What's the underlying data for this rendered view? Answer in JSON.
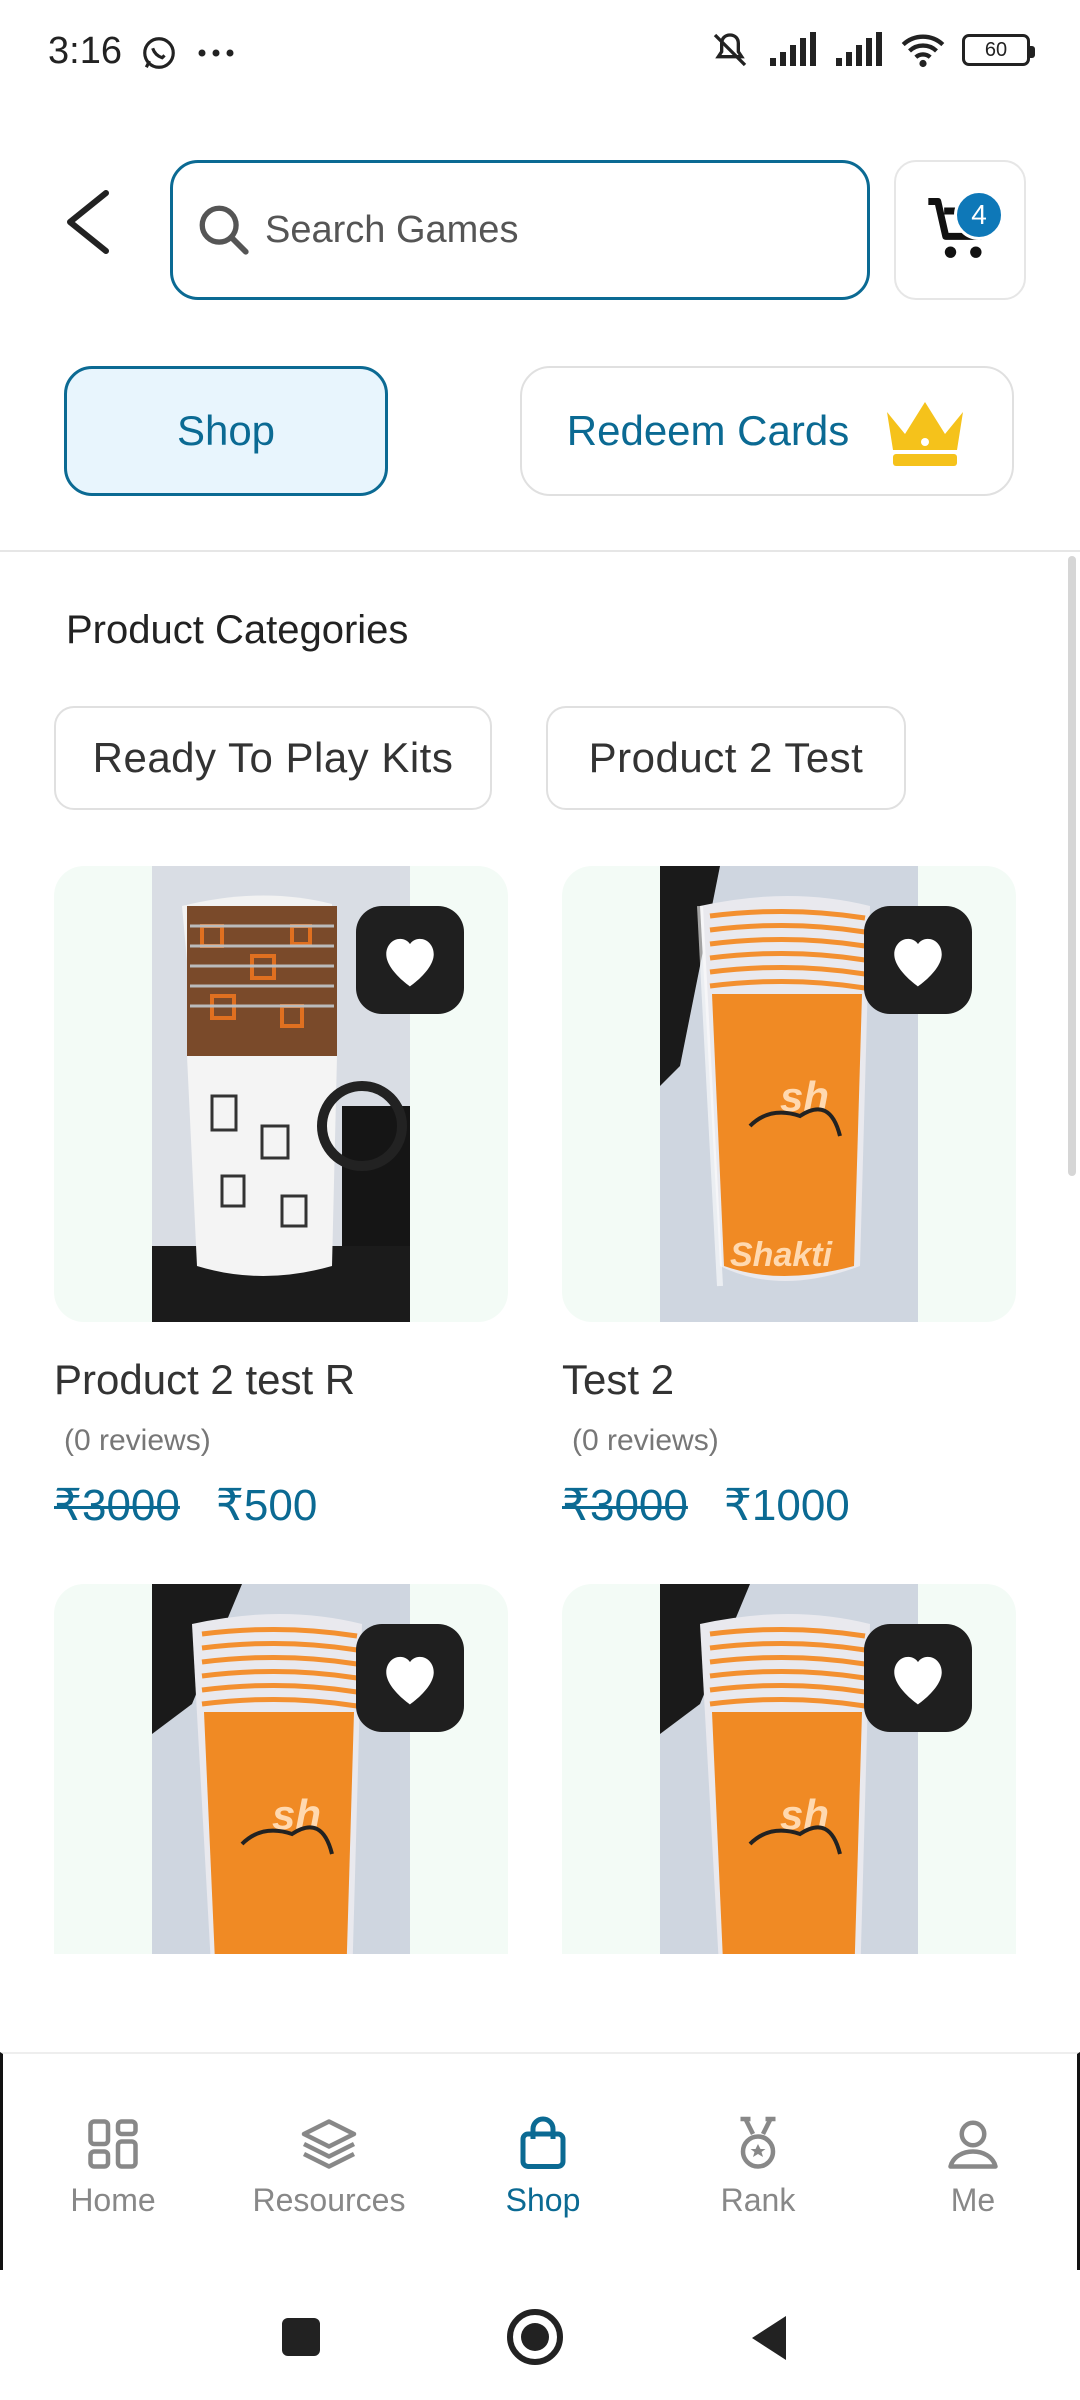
{
  "status_bar": {
    "time": "3:16",
    "battery": "60"
  },
  "header": {
    "search_placeholder": "Search Games",
    "cart_count": "4"
  },
  "top_tabs": {
    "shop": "Shop",
    "redeem": "Redeem Cards"
  },
  "categories": {
    "title": "Product Categories",
    "items": [
      "Ready To Play Kits",
      "Product 2 Test"
    ]
  },
  "products": [
    {
      "name": "Product 2 test R",
      "reviews": "(0 reviews)",
      "old_price": "₹3000",
      "price": "₹500"
    },
    {
      "name": "Test 2",
      "reviews": "(0 reviews)",
      "old_price": "₹3000",
      "price": "₹1000"
    },
    {
      "name": "",
      "reviews": "",
      "old_price": "",
      "price": ""
    },
    {
      "name": "",
      "reviews": "",
      "old_price": "",
      "price": ""
    }
  ],
  "bottom_nav": [
    {
      "label": "Home",
      "icon": "grid-icon"
    },
    {
      "label": "Resources",
      "icon": "layers-icon"
    },
    {
      "label": "Shop",
      "icon": "shopping-bag-icon",
      "active": true
    },
    {
      "label": "Rank",
      "icon": "medal-icon"
    },
    {
      "label": "Me",
      "icon": "user-icon"
    }
  ],
  "colors": {
    "accent": "#0b6a93",
    "badge": "#0e78b8",
    "crown": "#f5c21b",
    "card_bg": "#f3fbf6"
  }
}
